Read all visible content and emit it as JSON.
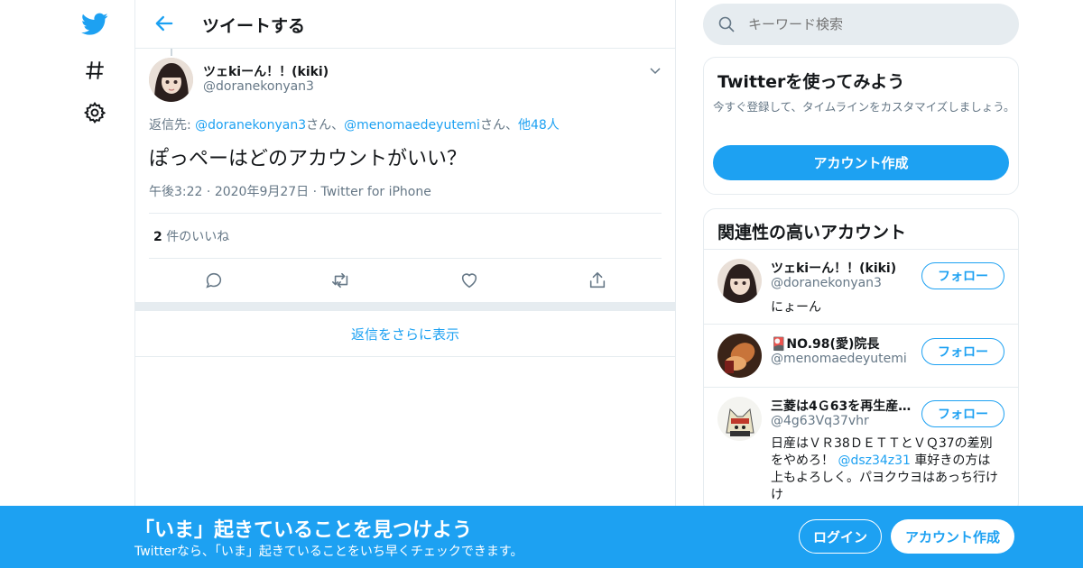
{
  "nav": {
    "icons": [
      "twitter-logo",
      "hashtag-icon",
      "gear-icon"
    ]
  },
  "header": {
    "title": "ツイートする"
  },
  "tweet": {
    "name": "ツェkiーん！！(kiki)",
    "handle": "@doranekonyan3",
    "reply_prefix": "返信先: ",
    "reply_user1": "@doranekonyan3",
    "reply_sep1": "さん、",
    "reply_user2": "@menomaedeyutemi",
    "reply_sep2": "さん、",
    "reply_more": "他48人",
    "text": "ぽっペーはどのアカウントがいい？",
    "time": "午後3:22",
    "date": "2020年9月27日",
    "source": "Twitter for iPhone",
    "likes_count": "2",
    "likes_label": "件のいいね"
  },
  "show_more_replies": "返信をさらに表示",
  "search": {
    "placeholder": "キーワード検索"
  },
  "signup_card": {
    "title": "Twitterを使ってみよう",
    "desc": "今すぐ登録して、タイムラインをカスタマイズしましょう。",
    "button": "アカウント作成"
  },
  "related": {
    "title": "関連性の高いアカウント",
    "follow_label": "フォロー",
    "accounts": [
      {
        "name": "ツェkiーん！！(kiki)",
        "handle": "@doranekonyan3",
        "bio": "にょーん"
      },
      {
        "name": "🎴NO.98(愛)院長",
        "handle": "@menomaedeyutemi",
        "bio": ""
      },
      {
        "name": "三菱は4Ｇ63を再生産…",
        "handle": "@4g63Vq37vhr",
        "bio_line1": "日産はＶＲ38ＤＥＴＴとＶＱ37の差別",
        "bio_line2a": "をやめろ！ ",
        "bio_mention": "@dsz34z31",
        "bio_line2b": " 車好きの方は",
        "bio_line3": "上もよろしく。パヨクウヨはあっち行け",
        "bio_line4": "け"
      }
    ]
  },
  "banner": {
    "title": "「いま」起きていることを見つけよう",
    "subtitle": "Twitterなら、「いま」起きていることをいち早くチェックできます。",
    "login": "ログイン",
    "signup": "アカウント作成"
  },
  "colors": {
    "accent": "#1da1f2",
    "border": "#e6ecf0",
    "muted": "#657786"
  }
}
